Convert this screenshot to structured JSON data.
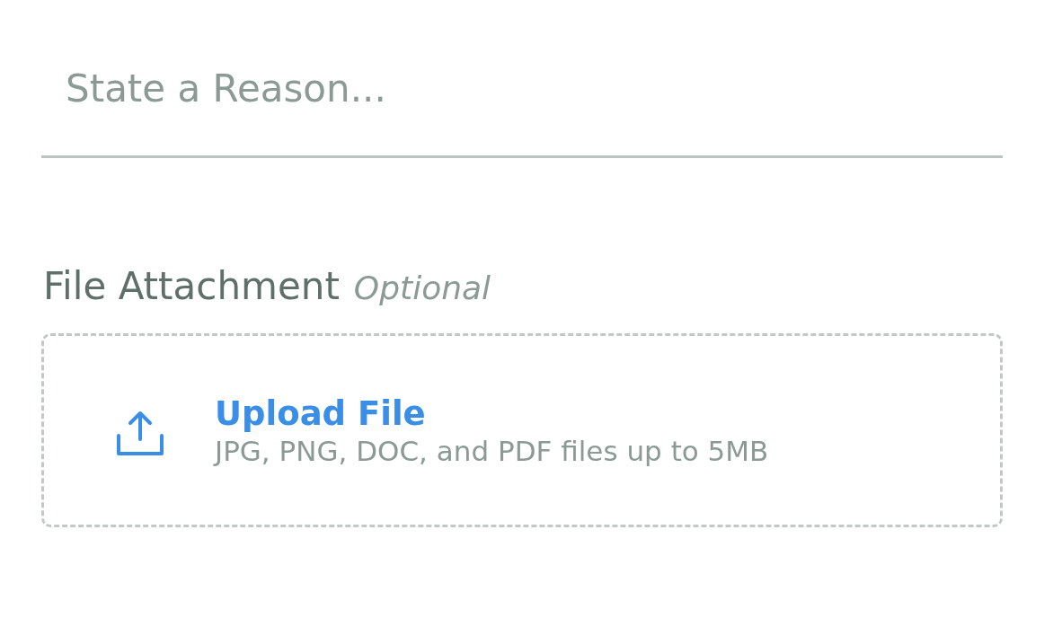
{
  "reason_field": {
    "placeholder": "State a Reason..."
  },
  "attachment": {
    "label": "File Attachment",
    "optional_tag": "Optional",
    "upload": {
      "title": "Upload File",
      "hint": "JPG, PNG, DOC, and PDF files up to 5MB"
    }
  }
}
